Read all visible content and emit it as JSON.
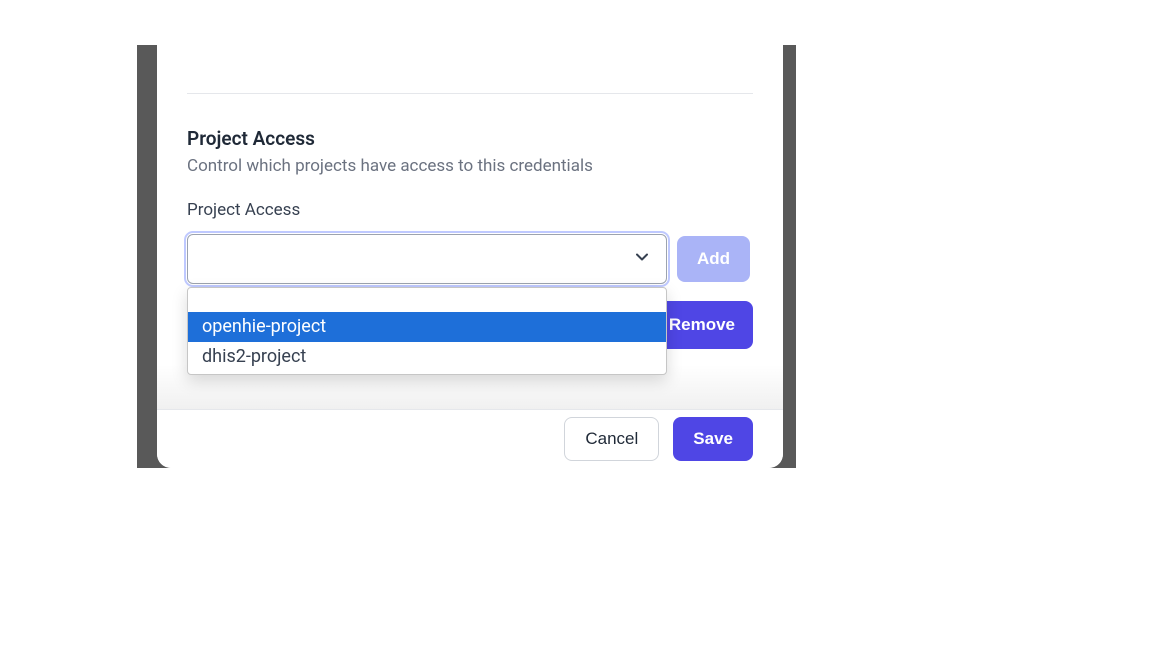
{
  "section": {
    "title": "Project Access",
    "description": "Control which projects have access to this credentials",
    "field_label": "Project Access",
    "add_label": "Add",
    "remove_label": "Remove"
  },
  "dropdown": {
    "options": [
      {
        "label": "openhie-project",
        "highlighted": true
      },
      {
        "label": "dhis2-project",
        "highlighted": false
      }
    ]
  },
  "footer": {
    "cancel_label": "Cancel",
    "save_label": "Save"
  }
}
